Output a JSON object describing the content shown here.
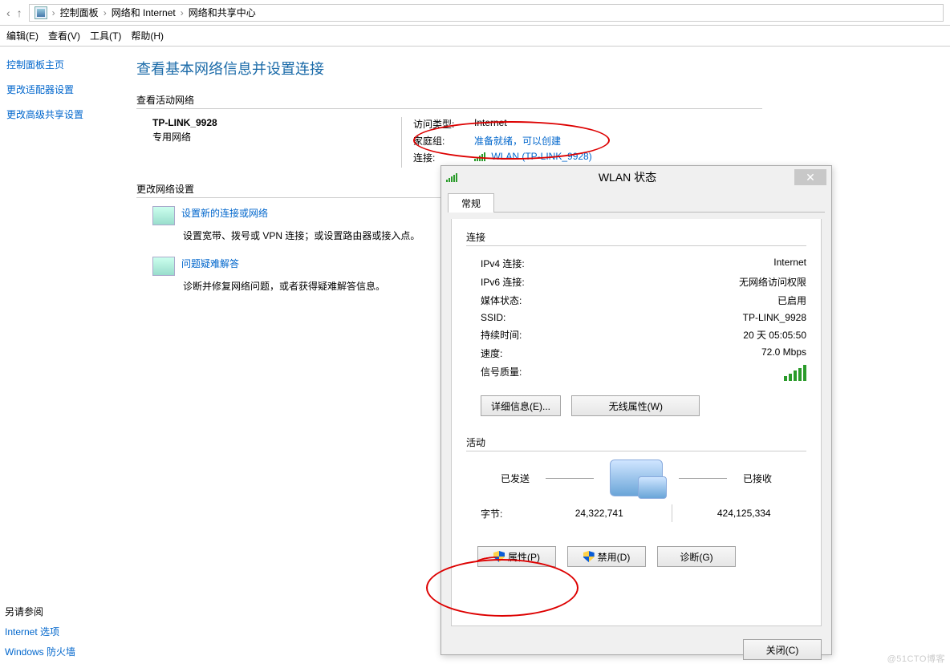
{
  "addressbar": {
    "up_arrow": "↑",
    "crumbs": [
      "控制面板",
      "网络和 Internet",
      "网络和共享中心"
    ],
    "sep": "›"
  },
  "menubar": {
    "items": [
      "编辑(E)",
      "查看(V)",
      "工具(T)",
      "帮助(H)"
    ]
  },
  "sidebar": {
    "title": "控制面板主页",
    "links": [
      "更改适配器设置",
      "更改高级共享设置"
    ]
  },
  "main": {
    "headline": "查看基本网络信息并设置连接",
    "active_section": "查看活动网络",
    "net_name": "TP-LINK_9928",
    "net_type": "专用网络",
    "kv": {
      "access_label": "访问类型:",
      "access_value": "Internet",
      "home_label": "家庭组:",
      "home_value": "准备就绪，可以创建",
      "conn_label": "连接:",
      "conn_value": "WLAN (TP-LINK_9928)"
    },
    "change_section": "更改网络设置",
    "opt1_link": "设置新的连接或网络",
    "opt1_desc": "设置宽带、拨号或 VPN 连接；或设置路由器或接入点。",
    "opt2_link": "问题疑难解答",
    "opt2_desc": "诊断并修复网络问题，或者获得疑难解答信息。"
  },
  "bottom": {
    "see_also": "另请参阅",
    "link1": "Internet 选项",
    "link2": "Windows 防火墙"
  },
  "dialog": {
    "title": "WLAN 状态",
    "tab": "常规",
    "section_conn": "连接",
    "rows": {
      "ipv4_k": "IPv4 连接:",
      "ipv4_v": "Internet",
      "ipv6_k": "IPv6 连接:",
      "ipv6_v": "无网络访问权限",
      "media_k": "媒体状态:",
      "media_v": "已启用",
      "ssid_k": "SSID:",
      "ssid_v": "TP-LINK_9928",
      "duration_k": "持续时间:",
      "duration_v": "20 天 05:05:50",
      "speed_k": "速度:",
      "speed_v": "72.0 Mbps",
      "signal_k": "信号质量:"
    },
    "btn_details": "详细信息(E)...",
    "btn_wireless": "无线属性(W)",
    "section_activity": "活动",
    "sent_label": "已发送",
    "recv_label": "已接收",
    "bytes_label": "字节:",
    "bytes_sent": "24,322,741",
    "bytes_recv": "424,125,334",
    "btn_props": "属性(P)",
    "btn_disable": "禁用(D)",
    "btn_diag": "诊断(G)",
    "btn_close": "关闭(C)"
  },
  "watermark": "@51CTO博客"
}
